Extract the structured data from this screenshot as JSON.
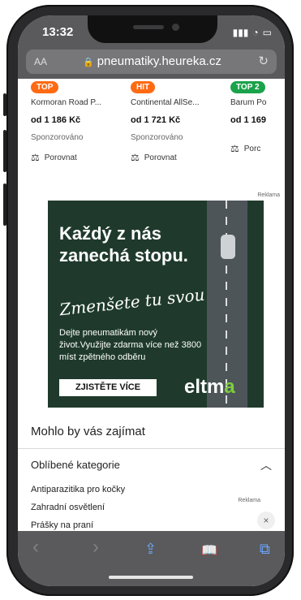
{
  "status": {
    "time": "13:32"
  },
  "browser": {
    "aa_label": "AA",
    "url": "pneumatiky.heureka.cz"
  },
  "products": [
    {
      "badge": "TOP",
      "badge_color": "#ff6a13",
      "name": "Kormoran Road P...",
      "price": "od 1 186 Kč",
      "sponsored": "Sponzorováno",
      "compare": "Porovnat"
    },
    {
      "badge": "HIT",
      "badge_color": "#ff6a13",
      "name": "Continental AllSe...",
      "price": "od 1 721 Kč",
      "sponsored": "Sponzorováno",
      "compare": "Porovnat"
    },
    {
      "badge": "TOP 2",
      "badge_color": "#1aa34a",
      "name": "Barum Po",
      "price": "od 1 169",
      "sponsored": "",
      "compare": "Porc"
    }
  ],
  "ad": {
    "reklama": "Reklama",
    "headline_line1": "Každý z nás",
    "headline_line2": "zanechá stopu.",
    "script": "Zmenšete tu svou",
    "body": "Dejte pneumatikám nový život.Využijte zdarma více než 3800 míst zpětného odběru",
    "cta": "ZJISTĚTE VÍCE",
    "logo_main": "eltm",
    "logo_accent": "a"
  },
  "section": {
    "title": "Mohlo by vás zajímat"
  },
  "categories": {
    "title": "Oblíbené kategorie",
    "items": [
      "Antiparazitika pro kočky",
      "Zahradní osvětlení",
      "Prášky na praní"
    ],
    "reklama": "Reklama",
    "close": "×"
  },
  "toolbar": {
    "back": "‹",
    "forward": "›",
    "share": "⇪",
    "bookmarks": "📖",
    "tabs": "⧉"
  }
}
